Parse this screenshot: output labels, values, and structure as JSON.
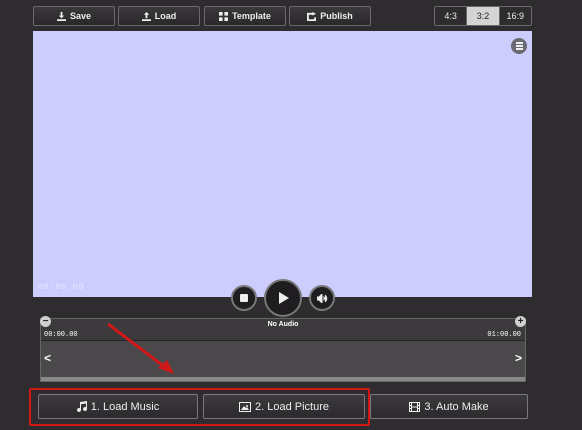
{
  "toolbar": {
    "save_label": "Save",
    "load_label": "Load",
    "template_label": "Template",
    "publish_label": "Publish"
  },
  "aspect_ratios": [
    "4:3",
    "3:2",
    "16:9"
  ],
  "selected_ratio": "3:2",
  "canvas": {
    "time": "00:00.00",
    "background_color": "#ccccfd"
  },
  "timeline": {
    "audio_label": "No Audio",
    "start_time": "00:00.00",
    "end_time": "01:00.00",
    "zoom_out": "−",
    "zoom_in": "+",
    "scroll_left": "<",
    "scroll_right": ">"
  },
  "actions": {
    "load_music": "1. Load Music",
    "load_picture": "2. Load Picture",
    "auto_make": "3. Auto Make"
  },
  "colors": {
    "background": "#2e2c2e",
    "highlight": "#d01818",
    "annotation_arrow": "#d01818"
  }
}
